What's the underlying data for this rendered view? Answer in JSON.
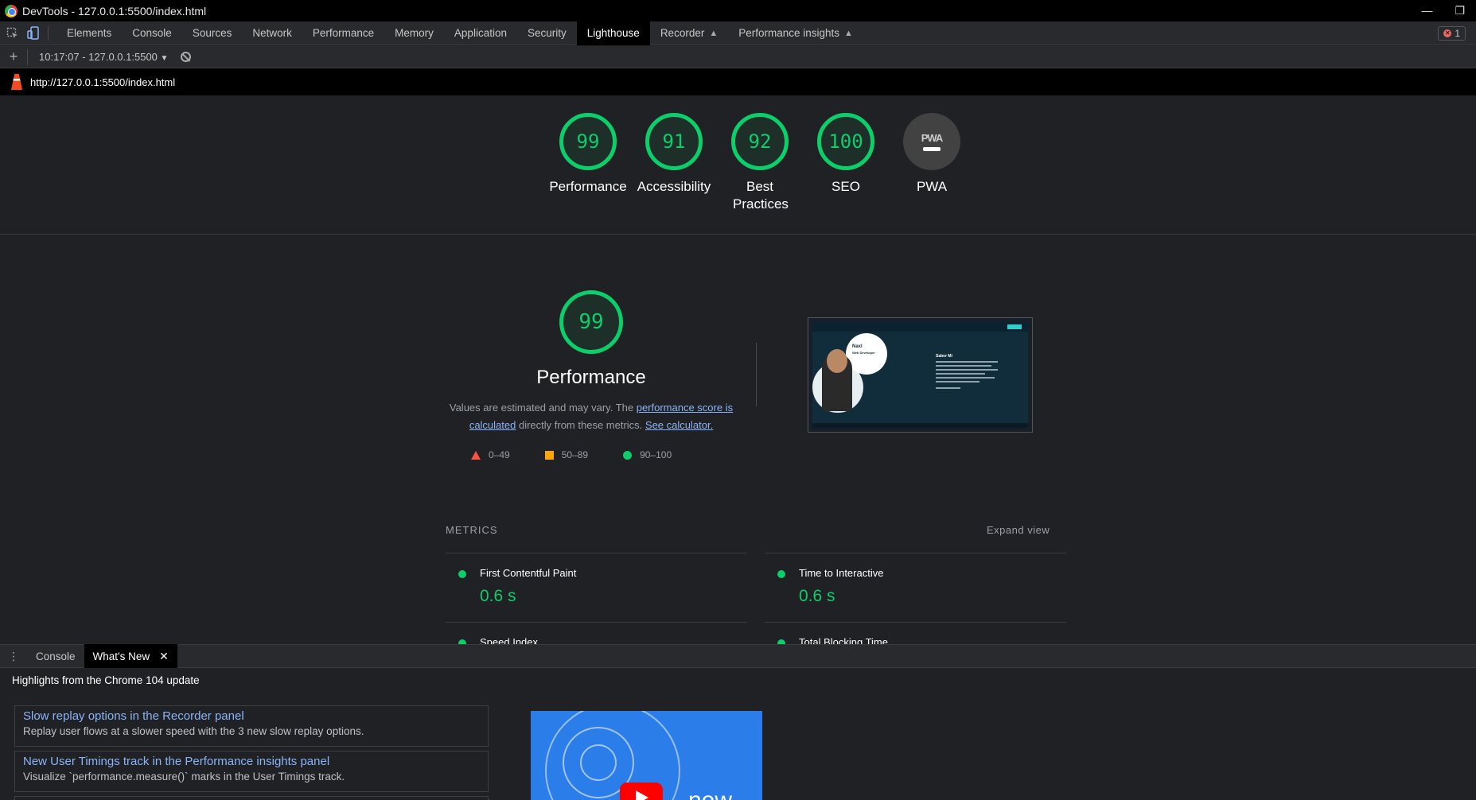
{
  "window": {
    "title": "DevTools - 127.0.0.1:5500/index.html",
    "min_glyph": "—",
    "restore_glyph": "❐"
  },
  "tabs": [
    {
      "label": "Elements"
    },
    {
      "label": "Console"
    },
    {
      "label": "Sources"
    },
    {
      "label": "Network"
    },
    {
      "label": "Performance"
    },
    {
      "label": "Memory"
    },
    {
      "label": "Application"
    },
    {
      "label": "Security"
    },
    {
      "label": "Lighthouse",
      "active": true
    },
    {
      "label": "Recorder",
      "experimental": true
    },
    {
      "label": "Performance insights",
      "experimental": true
    }
  ],
  "error_count": "1",
  "report_toolbar": {
    "add_glyph": "+",
    "report_select": "10:17:07 - 127.0.0.1:5500",
    "dropdown_glyph": "▼"
  },
  "url": "http://127.0.0.1:5500/index.html",
  "gauges": [
    {
      "score": "99",
      "label": "Performance"
    },
    {
      "score": "91",
      "label": "Accessibility"
    },
    {
      "score": "92",
      "label": "Best Practices"
    },
    {
      "score": "100",
      "label": "SEO"
    },
    {
      "score": "",
      "label": "PWA",
      "badge": "PWA"
    }
  ],
  "performance": {
    "score": "99",
    "title": "Performance",
    "desc_prefix": "Values are estimated and may vary. The ",
    "desc_link": "performance score is calculated",
    "desc_middle": " directly from these metrics. ",
    "desc_link2": "See calculator.",
    "legend": {
      "fail": "0–49",
      "average": "50–89",
      "pass": "90–100"
    }
  },
  "screenshot_thumb": {
    "name_line1": "Naxl",
    "name_line2": "Web Developer",
    "heading": "Saber Mí"
  },
  "metrics": {
    "header": "METRICS",
    "expand": "Expand view",
    "items": [
      {
        "label": "First Contentful Paint",
        "value": "0.6 s"
      },
      {
        "label": "Time to Interactive",
        "value": "0.6 s"
      },
      {
        "label": "Speed Index",
        "value": ""
      },
      {
        "label": "Total Blocking Time",
        "value": ""
      }
    ]
  },
  "drawer": {
    "menu_glyph": "⋮",
    "tabs": [
      {
        "label": "Console"
      },
      {
        "label": "What's New",
        "active": true
      }
    ],
    "close_glyph": "✕",
    "highlight": "Highlights from the Chrome 104 update",
    "cards": [
      {
        "title": "Slow replay options in the Recorder panel",
        "desc": "Replay user flows at a slower speed with the 3 new slow replay options."
      },
      {
        "title": "New User Timings track in the Performance insights panel",
        "desc": "Visualize `performance.measure()` marks in the User Timings track."
      }
    ],
    "video_text": "new"
  },
  "colors": {
    "pass": "#0cce6b",
    "average": "#ffa400",
    "fail": "#ff4e42",
    "link": "#8ab4f8",
    "active_tab_bg": "#000000"
  }
}
